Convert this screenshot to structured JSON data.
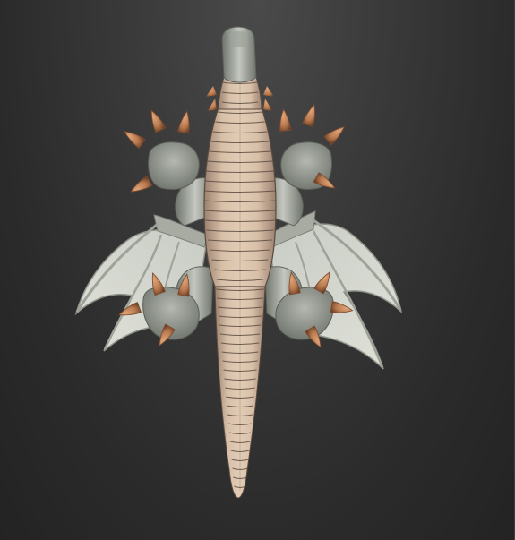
{
  "viewport": {
    "background_top": "#4a4a4a",
    "background_bottom": "#232323"
  },
  "model": {
    "subject": "dragon-model",
    "view": "top-down",
    "colors": {
      "belly": "#d8bfa8",
      "belly_dark": "#a88d76",
      "scale_line": "#5a4a3e",
      "skin": "#b9bdb5",
      "skin_dark": "#7c817a",
      "wing_membrane": "#d4d6ce",
      "wing_bone": "#9ea39a",
      "claw": "#c98a5e",
      "claw_dark": "#7a4a2e"
    }
  }
}
